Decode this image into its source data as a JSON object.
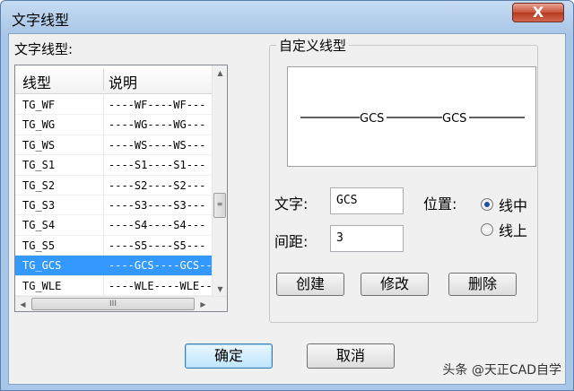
{
  "window": {
    "title": "文字线型",
    "close_glyph": "X"
  },
  "left": {
    "group_label": "文字线型:",
    "columns": [
      "线型",
      "说明"
    ],
    "rows": [
      {
        "name": "TG_WF",
        "desc": "----WF----WF---"
      },
      {
        "name": "TG_WG",
        "desc": "----WG----WG---"
      },
      {
        "name": "TG_WS",
        "desc": "----WS----WS---"
      },
      {
        "name": "TG_S1",
        "desc": "----S1----S1---"
      },
      {
        "name": "TG_S2",
        "desc": "----S2----S2---"
      },
      {
        "name": "TG_S3",
        "desc": "----S3----S3---"
      },
      {
        "name": "TG_S4",
        "desc": "----S4----S4---"
      },
      {
        "name": "TG_S5",
        "desc": "----S5----S5---"
      },
      {
        "name": "TG_GCS",
        "desc": "----GCS----GCS--"
      },
      {
        "name": "TG_WLE",
        "desc": "----WLE----WLE--"
      }
    ],
    "selected_row": "TG_GCS",
    "hscroll_grip": "III",
    "vscroll_grip": "≡"
  },
  "right": {
    "group_label": "自定义线型",
    "preview_texts": [
      "GCS",
      "GCS"
    ],
    "text_label": "文字:",
    "text_value": "GCS",
    "spacing_label": "间距:",
    "spacing_value": "3",
    "position_label": "位置:",
    "radio_center": "线中",
    "radio_above": "线上",
    "selected_position": "center"
  },
  "buttons": {
    "create": "创建",
    "modify": "修改",
    "delete": "删除",
    "ok": "确定",
    "cancel": "取消"
  },
  "watermark": "头条 @天正CAD自学"
}
